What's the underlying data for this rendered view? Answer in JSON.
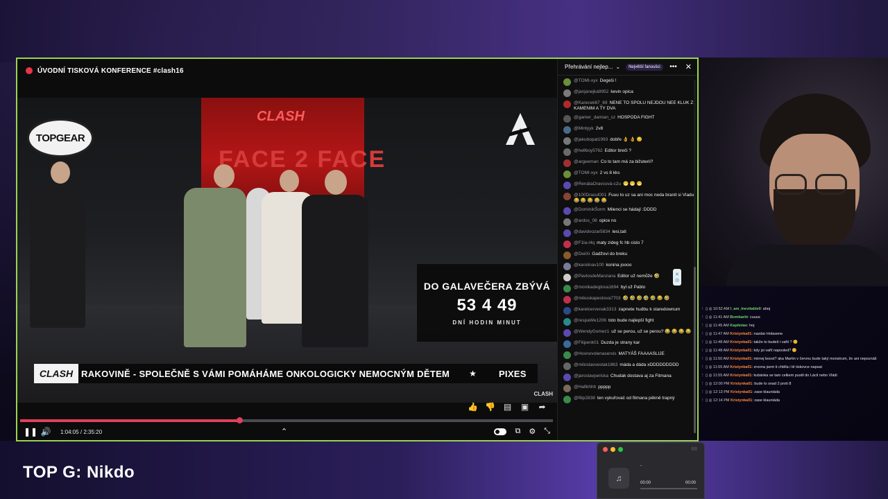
{
  "player": {
    "title": "ÚVODNÍ TISKOVÁ KONFERENCE #clash16",
    "overlay_logo": "TOPGEAR",
    "stage_logo": "CLASH",
    "stage_backdrop": "FACE 2 FACE",
    "countdown": {
      "title": "DO GALAVEČERA ZBÝVÁ",
      "numbers": "53 4 49",
      "units": "DNÍ  HODIN  MINUT"
    },
    "ticker": {
      "logo": "CLASH",
      "text": "RAKOVINĚ - SPOLEČNĚ S VÁMI POMÁHÁME ONKOLOGICKY NEMOCNÝM DĚTEM",
      "trailing": "PIXES"
    },
    "corner_logo": "CLASH",
    "time": "1:04:05 / 2:35:20",
    "progress": 0.412,
    "accent": "#e0405c"
  },
  "chat": {
    "selector": "Přehrávání nejlep...",
    "pill": "Největší fanoušci",
    "messages": [
      {
        "user": "@TOMI-xyx",
        "text": "Degeši !",
        "color": "#6b8f3a"
      },
      {
        "user": "@janjanejka9952",
        "text": "kevin opica",
        "color": "#7a7a7a"
      },
      {
        "user": "@Karecek67_69",
        "text": "NENE TO SPOLU NEJDOU NEE KLUK Z KAMENIM A TY DVA",
        "color": "#b02a2a"
      },
      {
        "user": "@gamer_damian_cz",
        "text": "HOSPODA FIGHT",
        "color": "#555"
      },
      {
        "user": "@Mintyyk",
        "text": "2v8",
        "color": "#4a6a8a"
      },
      {
        "user": "@jakubopat1993",
        "text": "dobře 👌 👌 😔",
        "color": "#777"
      },
      {
        "user": "@hellboy5762",
        "text": "Editor breči ?",
        "color": "#6a6a6a"
      },
      {
        "user": "@argeeman",
        "text": "Co to tam má za bižuterii?",
        "color": "#a03030"
      },
      {
        "user": "@TOMI-xyx",
        "text": "2 vs 8 kks",
        "color": "#6b8f3a"
      },
      {
        "user": "@RenátaOravcová-c2u",
        "text": "😁 😁 😁",
        "color": "#5a4ab0"
      },
      {
        "user": "@100Dracul001",
        "text": "Fuuu to uz sa ani moc neda branit si Vladu 😂 😂 😂 😂 😂",
        "color": "#884433"
      },
      {
        "user": "@DominikŠorm",
        "text": "Milenci se hádají :DDDD",
        "color": "#5a4ab0"
      },
      {
        "user": "@ardos_08",
        "text": "opice no",
        "color": "#777"
      },
      {
        "user": "@davidvozar5834",
        "text": "lesi,tati",
        "color": "#5a4ab0"
      },
      {
        "user": "@F1la-i4q",
        "text": "maty zideg fc hb cislo 7",
        "color": "#c0304a"
      },
      {
        "user": "@DwiXi",
        "text": "Gadžovi do breku",
        "color": "#8a5a2a"
      },
      {
        "user": "@karolinav100",
        "text": "konina joooo",
        "color": "#7a7a9a"
      },
      {
        "user": "@PavlosdeManzana",
        "text": "Editor už nemůže 🤣",
        "color": "#ccc"
      },
      {
        "user": "@monikadeglova1694",
        "text": "byl už Pablo",
        "color": "#3a8a4a"
      },
      {
        "user": "@mikuskapestova7703",
        "text": "🤣 🤣 🤣 🤣 🤣 😂 🤣",
        "color": "#c0304a"
      },
      {
        "user": "@karelcervenak3313",
        "text": "zapnete hudbu k staredownum",
        "color": "#2a4a8a"
      },
      {
        "user": "@respaWe1206",
        "text": "toto bude najlepší fight",
        "color": "#2a8a8a"
      },
      {
        "user": "@WendyGomez1",
        "text": "už se perou, už se perou? 😂 😂 😂 😂",
        "color": "#5a4ab0"
      },
      {
        "user": "@Filipenk01",
        "text": "Duzda je strany kar",
        "color": "#3a6aa0"
      },
      {
        "user": "@Hovnovolenaserxis",
        "text": "MATYÁŠ FAAAASLIJE",
        "color": "#3a8a4a"
      },
      {
        "user": "@miloslavsestak1863",
        "text": "máda a dáda xDDDDDDDDD",
        "color": "#666"
      },
      {
        "user": "@jaroslavpericka",
        "text": "Chudak dostava aj za Fitmana",
        "color": "#5a4ab0"
      },
      {
        "user": "@Hafikhhh",
        "text": "ppppp",
        "color": "#7a6a5a"
      },
      {
        "user": "@filip2838",
        "text": "ten vykuřovač od fitmana pěkně trapný",
        "color": "#3a8a4a"
      }
    ]
  },
  "chat2": [
    {
      "time": "10:52 AM",
      "name": "I_am_Inevitable0",
      "name_color": "#6fd46f",
      "text": ": ahoj"
    },
    {
      "time": "11:41 AM",
      "name": "Bombarkt",
      "name_color": "#6fd46f",
      "text": ": cuuus"
    },
    {
      "time": "11:45 AM",
      "name": "Kapitolae",
      "name_color": "#6fd46f",
      "text": ": hoj"
    },
    {
      "time": "11:47 AM",
      "name": "Kristynka01",
      "name_color": "#ff8a3c",
      "text": ": nazdar Holasene"
    },
    {
      "time": "11:48 AM",
      "name": "Kristynka01",
      "name_color": "#ff8a3c",
      "text": ": takže to budeš i vařit ? 😊"
    },
    {
      "time": "11:48 AM",
      "name": "Kristynka01",
      "name_color": "#ff8a3c",
      "text": ": kdy jsi vařil naposled? 😊"
    },
    {
      "time": "11:50 AM",
      "name": "Kristynka01",
      "name_color": "#ff8a3c",
      "text": ": mirnej boost? aka Martin v červnu bude taký monstrum, že ani nepoznáš"
    },
    {
      "time": "11:55 AM",
      "name": "Kristynka01",
      "name_color": "#ff8a3c",
      "text": ": zrovna jsem ti chtěla i tě tiskovce napsat"
    },
    {
      "time": "11:55 AM",
      "name": "Kristynka01",
      "name_color": "#ff8a3c",
      "text": ": kubánka se tam celkem pustil do Lácil nebo Vládi"
    },
    {
      "time": "12:00 PM",
      "name": "Kristynka01",
      "name_color": "#ff8a3c",
      "text": ": bude to snad 2 proti 8"
    },
    {
      "time": "12:13 PM",
      "name": "Kristynka01",
      "name_color": "#ff8a3c",
      "text": ": zase klauniáda"
    },
    {
      "time": "12:14 PM",
      "name": "Kristynka01",
      "name_color": "#ff8a3c",
      "text": ": zase klauniáda"
    }
  ],
  "overlay_label": "TOP G: Nikdo",
  "mini_player": {
    "title": "-",
    "time_left": "00:00",
    "time_right": "00:00",
    "progress": 0
  }
}
